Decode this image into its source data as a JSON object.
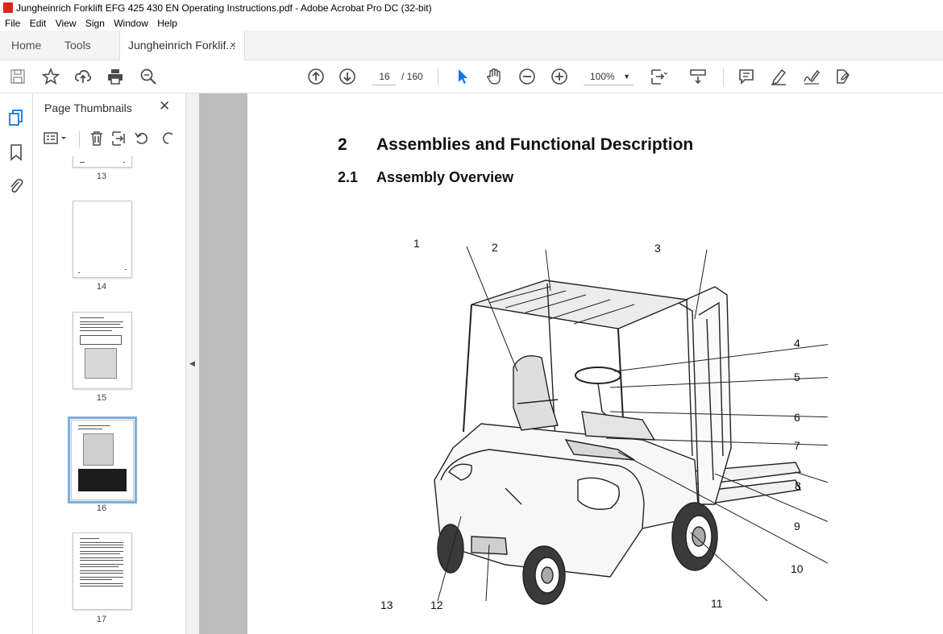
{
  "window": {
    "title": "Jungheinrich Forklift EFG 425 430 EN Operating Instructions.pdf - Adobe Acrobat Pro DC (32-bit)"
  },
  "menu": [
    "File",
    "Edit",
    "View",
    "Sign",
    "Window",
    "Help"
  ],
  "tabs": {
    "home": "Home",
    "tools": "Tools",
    "document": "Jungheinrich Forklif...",
    "close": "×"
  },
  "toolbar": {
    "current_page": "16",
    "total_pages": "/ 160",
    "zoom": "100%"
  },
  "icons": [
    "save-icon",
    "star-icon",
    "upload-icon",
    "print-icon",
    "search-icon",
    "page-up-icon",
    "page-down-icon",
    "select-arrow-icon",
    "hand-icon",
    "zoom-out-icon",
    "zoom-in-icon",
    "fit-page-icon",
    "scroll-mode-icon",
    "comment-icon",
    "highlight-icon",
    "sign-icon",
    "fill-sign-icon"
  ],
  "panel": {
    "title": "Page Thumbnails",
    "close": "✕"
  },
  "thumbnails": [
    {
      "label": "13"
    },
    {
      "label": "14"
    },
    {
      "label": "15"
    },
    {
      "label": "16",
      "selected": true
    },
    {
      "label": "17"
    }
  ],
  "document": {
    "section_number": "2",
    "section_title": "Assemblies and Functional Description",
    "subsection_number": "2.1",
    "subsection_title": "Assembly Overview",
    "callouts": [
      "1",
      "2",
      "3",
      "4",
      "5",
      "6",
      "7",
      "8",
      "9",
      "10",
      "11",
      "12",
      "13"
    ]
  },
  "colors": {
    "accent": "#1473e6",
    "acrobat_red": "#d9261c",
    "viewer_bg": "#bdbdbd"
  }
}
